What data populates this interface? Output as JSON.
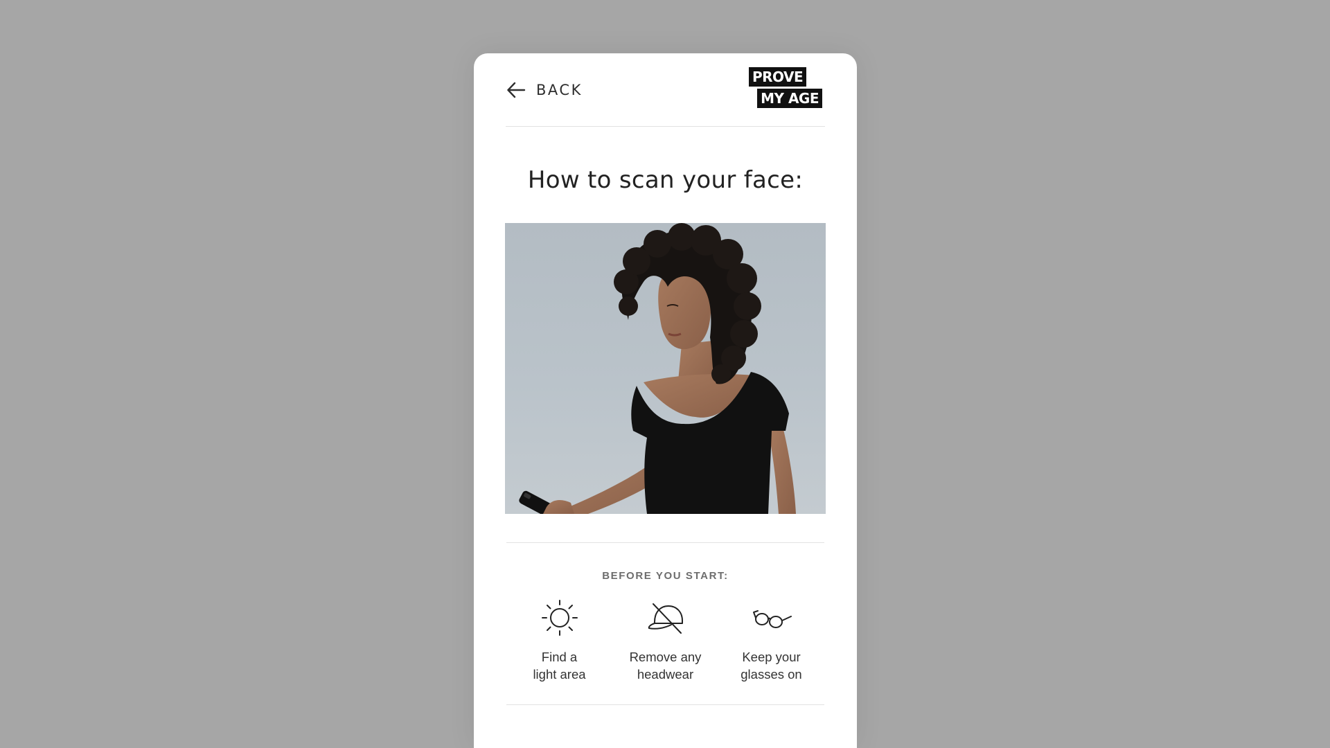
{
  "header": {
    "back_label": "BACK",
    "back_icon": "arrow-left-icon",
    "logo": {
      "line1": "PROVE",
      "line2": "MY AGE"
    }
  },
  "main": {
    "title": "How to scan your face:",
    "hero_image": "woman-looking-at-phone-photo"
  },
  "before_you_start": {
    "label": "BEFORE YOU START:",
    "tips": [
      {
        "icon": "sun-icon",
        "line1": "Find a",
        "line2": "light area"
      },
      {
        "icon": "no-cap-icon",
        "line1": "Remove any",
        "line2": "headwear"
      },
      {
        "icon": "glasses-icon",
        "line1": "Keep your",
        "line2": "glasses on"
      }
    ]
  },
  "colors": {
    "background": "#a6a6a6",
    "card": "#ffffff",
    "text": "#222222",
    "logo_bg": "#111111"
  }
}
